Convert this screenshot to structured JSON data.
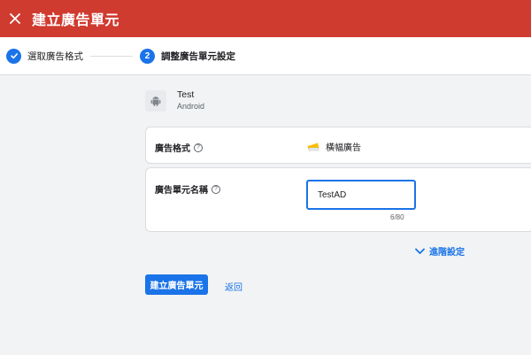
{
  "header": {
    "title": "建立廣告單元",
    "close_icon": "close-icon",
    "color": "#d03b30"
  },
  "stepper": {
    "steps": [
      {
        "label": "選取廣告格式",
        "state": "completed",
        "icon": "check-icon"
      },
      {
        "label": "調整廣告單元設定",
        "state": "active",
        "number": "2"
      }
    ]
  },
  "app": {
    "name": "Test",
    "platform": "Android",
    "icon": "android-icon"
  },
  "form": {
    "format_label": "廣告格式",
    "format_value": "橫幅廣告",
    "format_icon": "banner-icon",
    "name_label": "廣告單元名稱",
    "name_value": "TestAD",
    "char_count": "6/80",
    "help_icon": "help-icon"
  },
  "advanced_settings_label": "進階設定",
  "actions": {
    "create_label": "建立廣告單元",
    "back_label": "返回"
  },
  "colors": {
    "primary": "#1a73e8",
    "header": "#d03b30",
    "background": "#f1f3f4"
  }
}
